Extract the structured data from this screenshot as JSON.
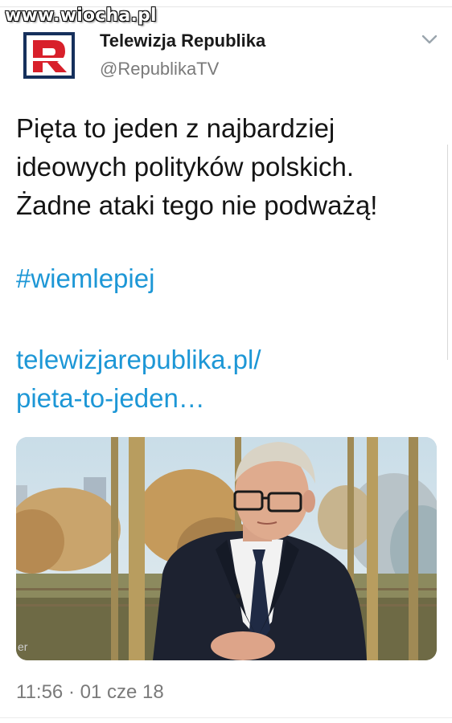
{
  "watermark": "www.wiocha.pl",
  "tweet": {
    "display_name": "Telewizja Republika",
    "handle": "@RepublikaTV",
    "text_lines": [
      "Pięta to jeden z najbardziej",
      "ideowych polityków polskich.",
      "Żadne ataki tego nie podważą!"
    ],
    "hashtag": "#wiemlepiej",
    "link_lines": [
      "telewizjarepublika.pl/",
      "pieta-to-jeden…"
    ],
    "timestamp": "11:56 · 01 cze 18"
  },
  "icons": {
    "avatar": "republika-logo-icon",
    "menu": "chevron-down-icon"
  },
  "colors": {
    "link": "#1d97d6",
    "text": "#141414",
    "muted": "#7a7a7a",
    "logo_red": "#d8202b",
    "logo_navy": "#16305c"
  }
}
